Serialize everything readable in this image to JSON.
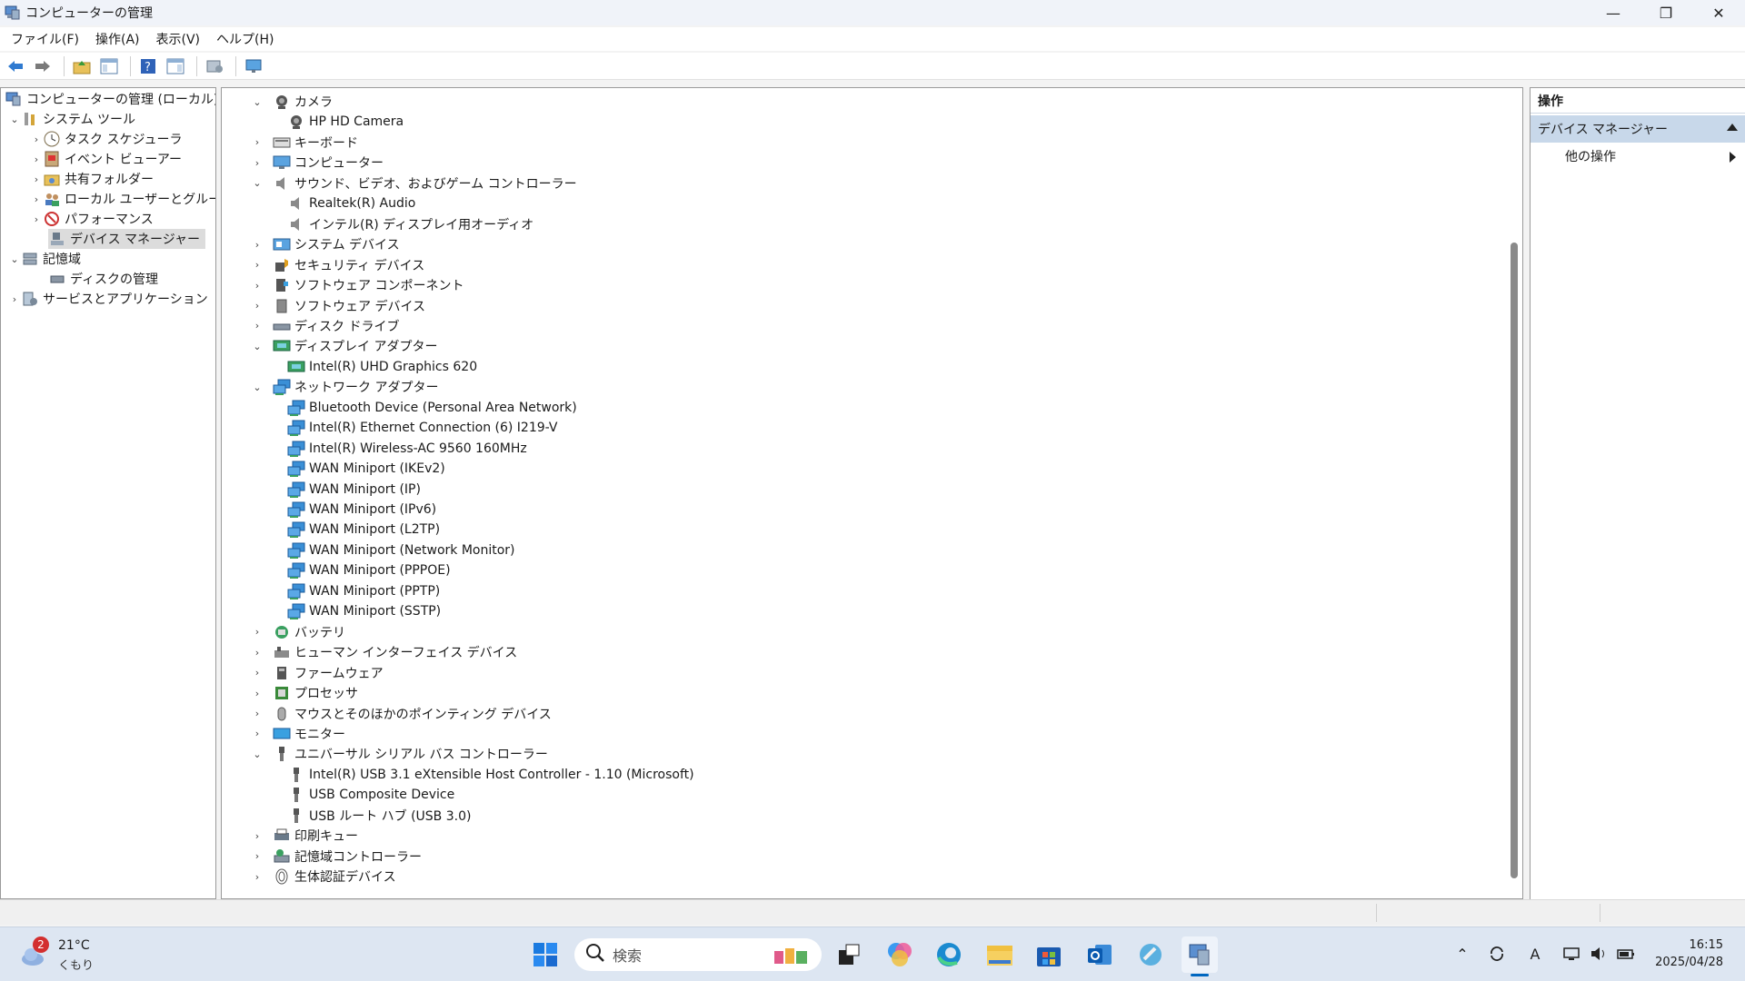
{
  "window": {
    "title": "コンピューターの管理"
  },
  "menu": [
    "ファイル(F)",
    "操作(A)",
    "表示(V)",
    "ヘルプ(H)"
  ],
  "left_tree": {
    "root": "コンピューターの管理 (ローカル)",
    "system_tools": "システム ツール",
    "task_scheduler": "タスク スケジューラ",
    "event_viewer": "イベント ビューアー",
    "shared_folders": "共有フォルダー",
    "local_users": "ローカル ユーザーとグループ",
    "performance": "パフォーマンス",
    "device_manager": "デバイス マネージャー",
    "storage": "記憶域",
    "disk_management": "ディスクの管理",
    "services_apps": "サービスとアプリケーション"
  },
  "devices": {
    "camera": "カメラ",
    "hp_camera": "HP HD Camera",
    "keyboard": "キーボード",
    "computer": "コンピューター",
    "sound": "サウンド、ビデオ、およびゲーム コントローラー",
    "realtek": "Realtek(R) Audio",
    "intel_display_audio": "インテル(R) ディスプレイ用オーディオ",
    "system_devices": "システム デバイス",
    "security_devices": "セキュリティ デバイス",
    "software_components": "ソフトウェア コンポーネント",
    "software_devices": "ソフトウェア デバイス",
    "disk_drives": "ディスク ドライブ",
    "display_adapters": "ディスプレイ アダプター",
    "uhd620": "Intel(R) UHD Graphics 620",
    "network_adapters": "ネットワーク アダプター",
    "net": [
      "Bluetooth Device (Personal Area Network)",
      "Intel(R) Ethernet Connection (6) I219-V",
      "Intel(R) Wireless-AC 9560 160MHz",
      "WAN Miniport (IKEv2)",
      "WAN Miniport (IP)",
      "WAN Miniport (IPv6)",
      "WAN Miniport (L2TP)",
      "WAN Miniport (Network Monitor)",
      "WAN Miniport (PPPOE)",
      "WAN Miniport (PPTP)",
      "WAN Miniport (SSTP)"
    ],
    "battery": "バッテリ",
    "hid": "ヒューマン インターフェイス デバイス",
    "firmware": "ファームウェア",
    "processor": "プロセッサ",
    "mice": "マウスとそのほかのポインティング デバイス",
    "monitor": "モニター",
    "usb_controllers": "ユニバーサル シリアル バス コントローラー",
    "usb": [
      "Intel(R) USB 3.1 eXtensible Host Controller - 1.10 (Microsoft)",
      "USB Composite Device",
      "USB ルート ハブ (USB 3.0)"
    ],
    "print_queue": "印刷キュー",
    "storage_controllers": "記憶域コントローラー",
    "biometric": "生体認証デバイス"
  },
  "actions": {
    "header": "操作",
    "selected": "デバイス マネージャー",
    "other": "他の操作"
  },
  "taskbar": {
    "weather_temp": "21°C",
    "weather_cond": "くもり",
    "weather_badge": "2",
    "search_placeholder": "検索",
    "time": "16:15",
    "date": "2025/04/28",
    "ime": "A"
  },
  "colors": {
    "accent": "#0067c0",
    "selection": "#c8d8ea",
    "net_icon": "#3a8fd6"
  }
}
